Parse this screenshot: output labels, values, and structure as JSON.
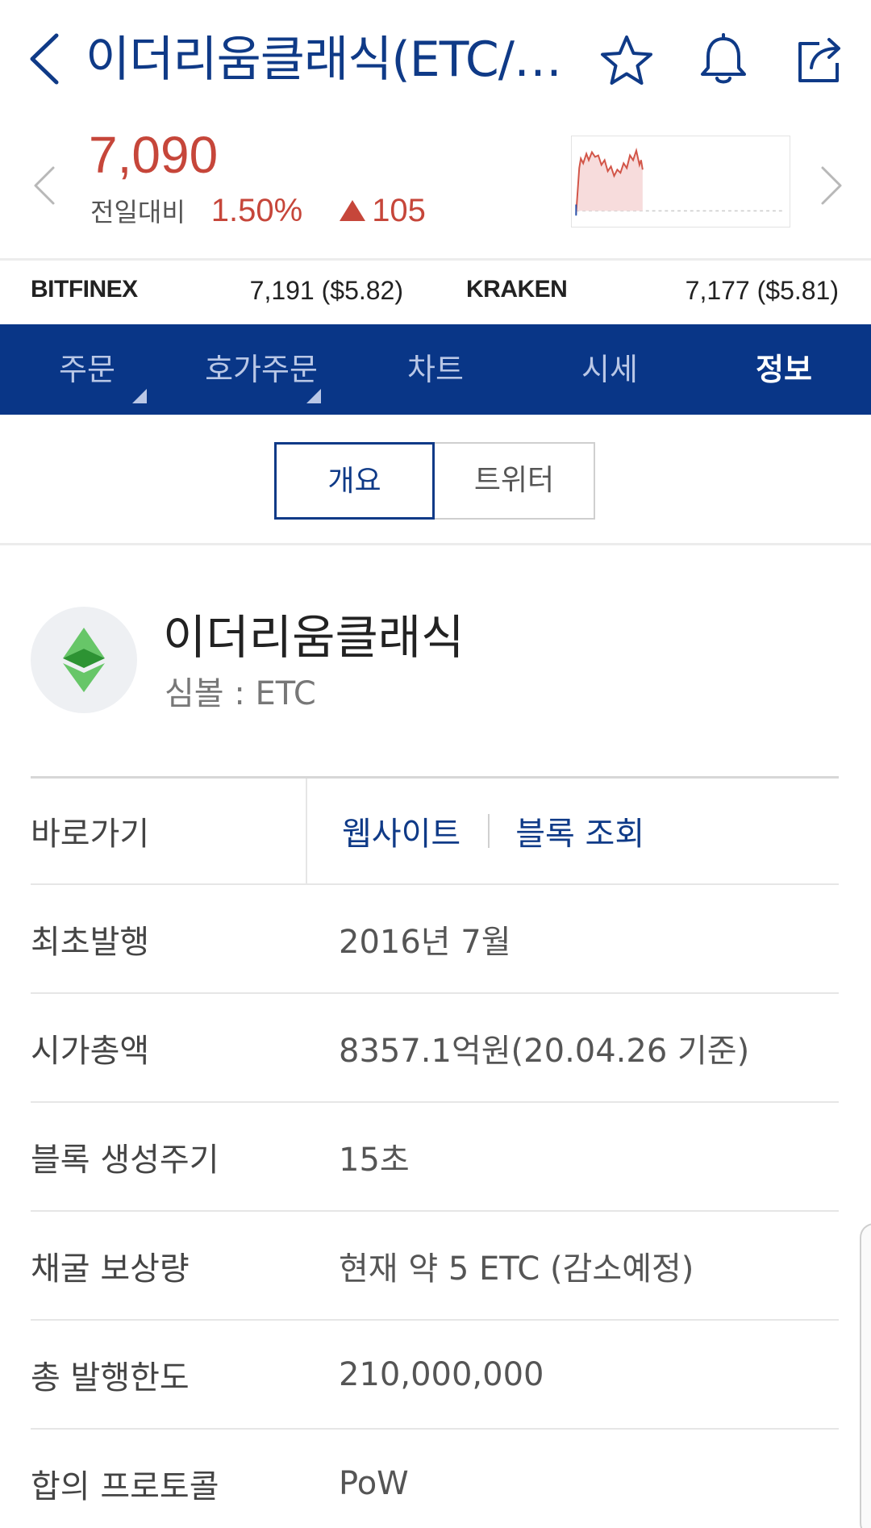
{
  "header": {
    "title": "이더리움클래식(ETC/KRW)",
    "icons": [
      "back-icon",
      "star-icon",
      "bell-icon",
      "share-icon"
    ]
  },
  "price": {
    "current": "7,090",
    "change_label": "전일대비",
    "change_percent": "1.50%",
    "change_value": "105",
    "direction_icon": "triangle-up-icon",
    "color_up": "#c6463a"
  },
  "exchanges": [
    {
      "name": "BITFINEX",
      "price": "7,191 ($5.82)"
    },
    {
      "name": "KRAKEN",
      "price": "7,177 ($5.81)"
    }
  ],
  "tabs": [
    {
      "label": "주문",
      "has_corner": true
    },
    {
      "label": "호가주문",
      "has_corner": true
    },
    {
      "label": "차트",
      "has_corner": false
    },
    {
      "label": "시세",
      "has_corner": false
    },
    {
      "label": "정보",
      "has_corner": false,
      "active": true
    }
  ],
  "segment": {
    "options": [
      "개요",
      "트위터"
    ],
    "selected": "개요"
  },
  "coin": {
    "name": "이더리움클래식",
    "symbol": "심볼 : ETC",
    "logo_icon": "ethereum-classic-icon"
  },
  "info": {
    "shortcut_label": "바로가기",
    "links": [
      "웹사이트",
      "블록 조회"
    ],
    "rows": [
      {
        "label": "최초발행",
        "value": "2016년 7월"
      },
      {
        "label": "시가총액",
        "value": "8357.1억원(20.04.26 기준)"
      },
      {
        "label": "블록 생성주기",
        "value": "15초"
      },
      {
        "label": "채굴 보상량",
        "value": "현재 약 5 ETC (감소예정)"
      },
      {
        "label": "총 발행한도",
        "value": "210,000,000"
      },
      {
        "label": "합의 프로토콜",
        "value": "PoW"
      }
    ]
  },
  "colors": {
    "brand": "#093687",
    "title": "#0f3a87",
    "up": "#c6463a"
  }
}
